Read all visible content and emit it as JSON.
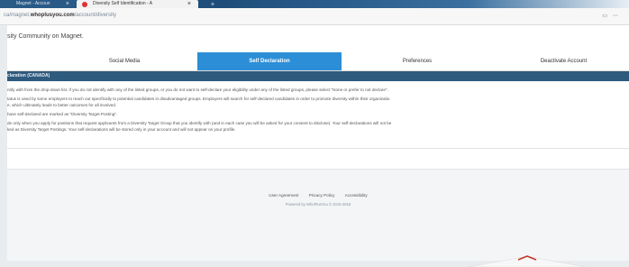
{
  "browser": {
    "tabs": [
      {
        "label": "Magnet - Accoun"
      },
      {
        "label": "Diversity Self Identification - A"
      }
    ],
    "url_prefix": "ca/magnet.",
    "url_domain": "whoplusyou.com",
    "url_path": "/account/diversity"
  },
  "page": {
    "title": "sity Community on Magnet.",
    "nav": {
      "social_media": "Social Media",
      "self_declaration": "Self Declaration",
      "preferences": "Preferences",
      "deactivate": "Deactivate Account"
    },
    "section_title": "claration (CANADA)",
    "paragraphs": [
      "ntify with from the drop-down list. If you do not identify with any of the listed groups, or you do not want to self-declare your eligibility under any of the listed groups, please select \"None or prefer to not declare\".",
      "tatus is used by some employers to reach out specifically to potential candidates in disadvantaged groups. Employers will search for self-declared candidates in order to promote diversity within their organizatio",
      "e, which ultimately leads to better outcomes for all involved.",
      "have self-declared are marked as \"Diversity Target Posting\".",
      "de only when you apply for positions that request applicants from a Diversity Target Group that you identify with (and in each case you will be asked for your consent to disclose). Your self-declarations will not be",
      "ked as Diversity Target Postings. Your self-declarations will be stored only in your account and will not appear on your profile."
    ]
  },
  "footer": {
    "links": [
      "User Agreement",
      "Privacy Policy",
      "Accessibility"
    ],
    "copyright": "Powered by WhoPlusYou © 2015-2018"
  },
  "colors": {
    "active_tab": "#2b8ed6",
    "section_bar": "#2e5a7d",
    "browser_tabbar": "#1f4e7a"
  }
}
